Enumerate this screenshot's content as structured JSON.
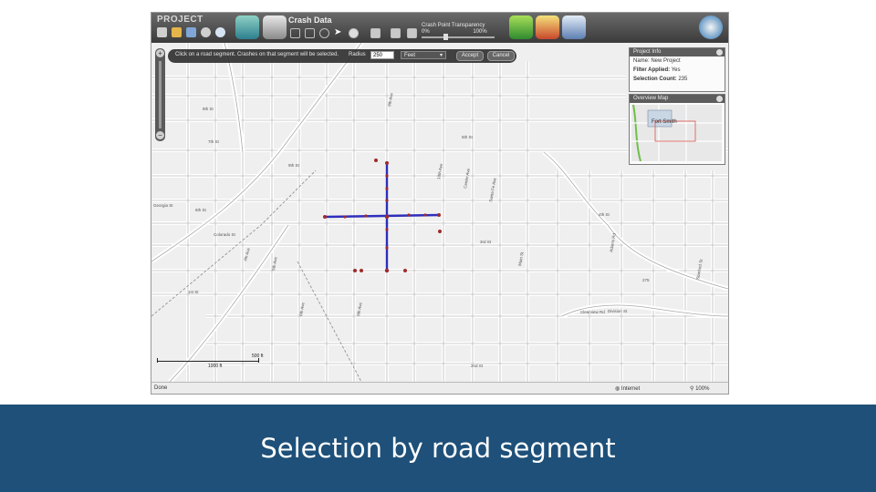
{
  "app": {
    "brand": "PROJECT",
    "group_label": "Crash Data",
    "transparency_label": "Crash Point Transparency",
    "transparency_min": "0%",
    "transparency_max": "100%",
    "transparency_value": 0.35
  },
  "selection_panel": {
    "instruction": "Click on a road segment. Crashes on that segment will be selected.",
    "radius_label": "Radius",
    "radius_value": "250",
    "unit_selected": "Feet",
    "accept_label": "Accept",
    "cancel_label": "Cancel"
  },
  "project_info": {
    "title": "Project Info",
    "name_label": "Name:",
    "name_value": "New Project",
    "filter_label": "Filter Applied:",
    "filter_value": "Yes",
    "count_label": "Selection Count:",
    "count_value": "235"
  },
  "overview": {
    "title": "Overview Map",
    "city": "Fort Smith"
  },
  "map": {
    "streets": [
      "8th St",
      "9th St",
      "7th St",
      "6th St",
      "5th St",
      "4th St",
      "3rd St",
      "2nd St",
      "1st St",
      "Georgia St",
      "Colorado St",
      "Clearview Rd",
      "Division St",
      "4th Ave",
      "5th Ave",
      "6th Ave",
      "8th Ave",
      "9th Ave",
      "10th Ave",
      "Center Ave",
      "Santa Fe Ave",
      "Main St",
      "Adams Rd",
      "Stanford St"
    ],
    "highway_label": "275",
    "scale_text_1": "500 ft",
    "scale_text_2": "1000 ft",
    "highlight_color": "#2e2ebc",
    "crash_point_color": "#a02a2a"
  },
  "statusbar": {
    "left": "Done",
    "zone": "Internet",
    "zoom": "100%"
  },
  "caption": "Selection by road segment"
}
